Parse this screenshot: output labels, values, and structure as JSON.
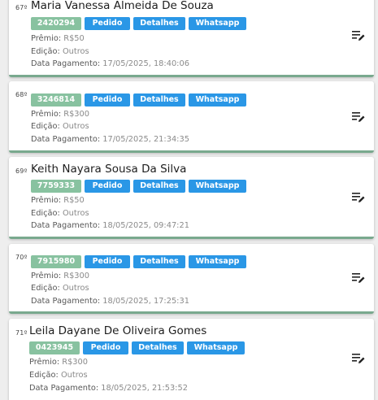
{
  "labels": {
    "premio": "Prêmio:",
    "edicao": "Edição:",
    "pagamento": "Data Pagamento:",
    "pedido": "Pedido",
    "detalhes": "Detalhes",
    "whatsapp": "Whatsapp"
  },
  "icons": {
    "edit": "edit-list-icon"
  },
  "colors": {
    "code_chip": "#88c2a0",
    "action_button": "#2a97e6",
    "card_border": "#79a98e"
  },
  "entries": [
    {
      "rank": "67º",
      "name": "Maria Vanessa Almeida De Souza",
      "code": "2420294",
      "premio": "R$50",
      "edicao": "Outros",
      "pagamento": "17/05/2025, 18:40:06"
    },
    {
      "rank": "68º",
      "name": "",
      "code": "3246814",
      "premio": "R$300",
      "edicao": "Outros",
      "pagamento": "17/05/2025, 21:34:35"
    },
    {
      "rank": "69º",
      "name": "Keith Nayara Sousa Da Silva",
      "code": "7759333",
      "premio": "R$50",
      "edicao": "Outros",
      "pagamento": "18/05/2025, 09:47:21"
    },
    {
      "rank": "70º",
      "name": "",
      "code": "7915980",
      "premio": "R$300",
      "edicao": "Outros",
      "pagamento": "18/05/2025, 17:25:31"
    },
    {
      "rank": "71º",
      "name": "Leila Dayane De Oliveira Gomes",
      "code": "0423945",
      "premio": "R$300",
      "edicao": "Outros",
      "pagamento": "18/05/2025, 21:53:52"
    }
  ]
}
